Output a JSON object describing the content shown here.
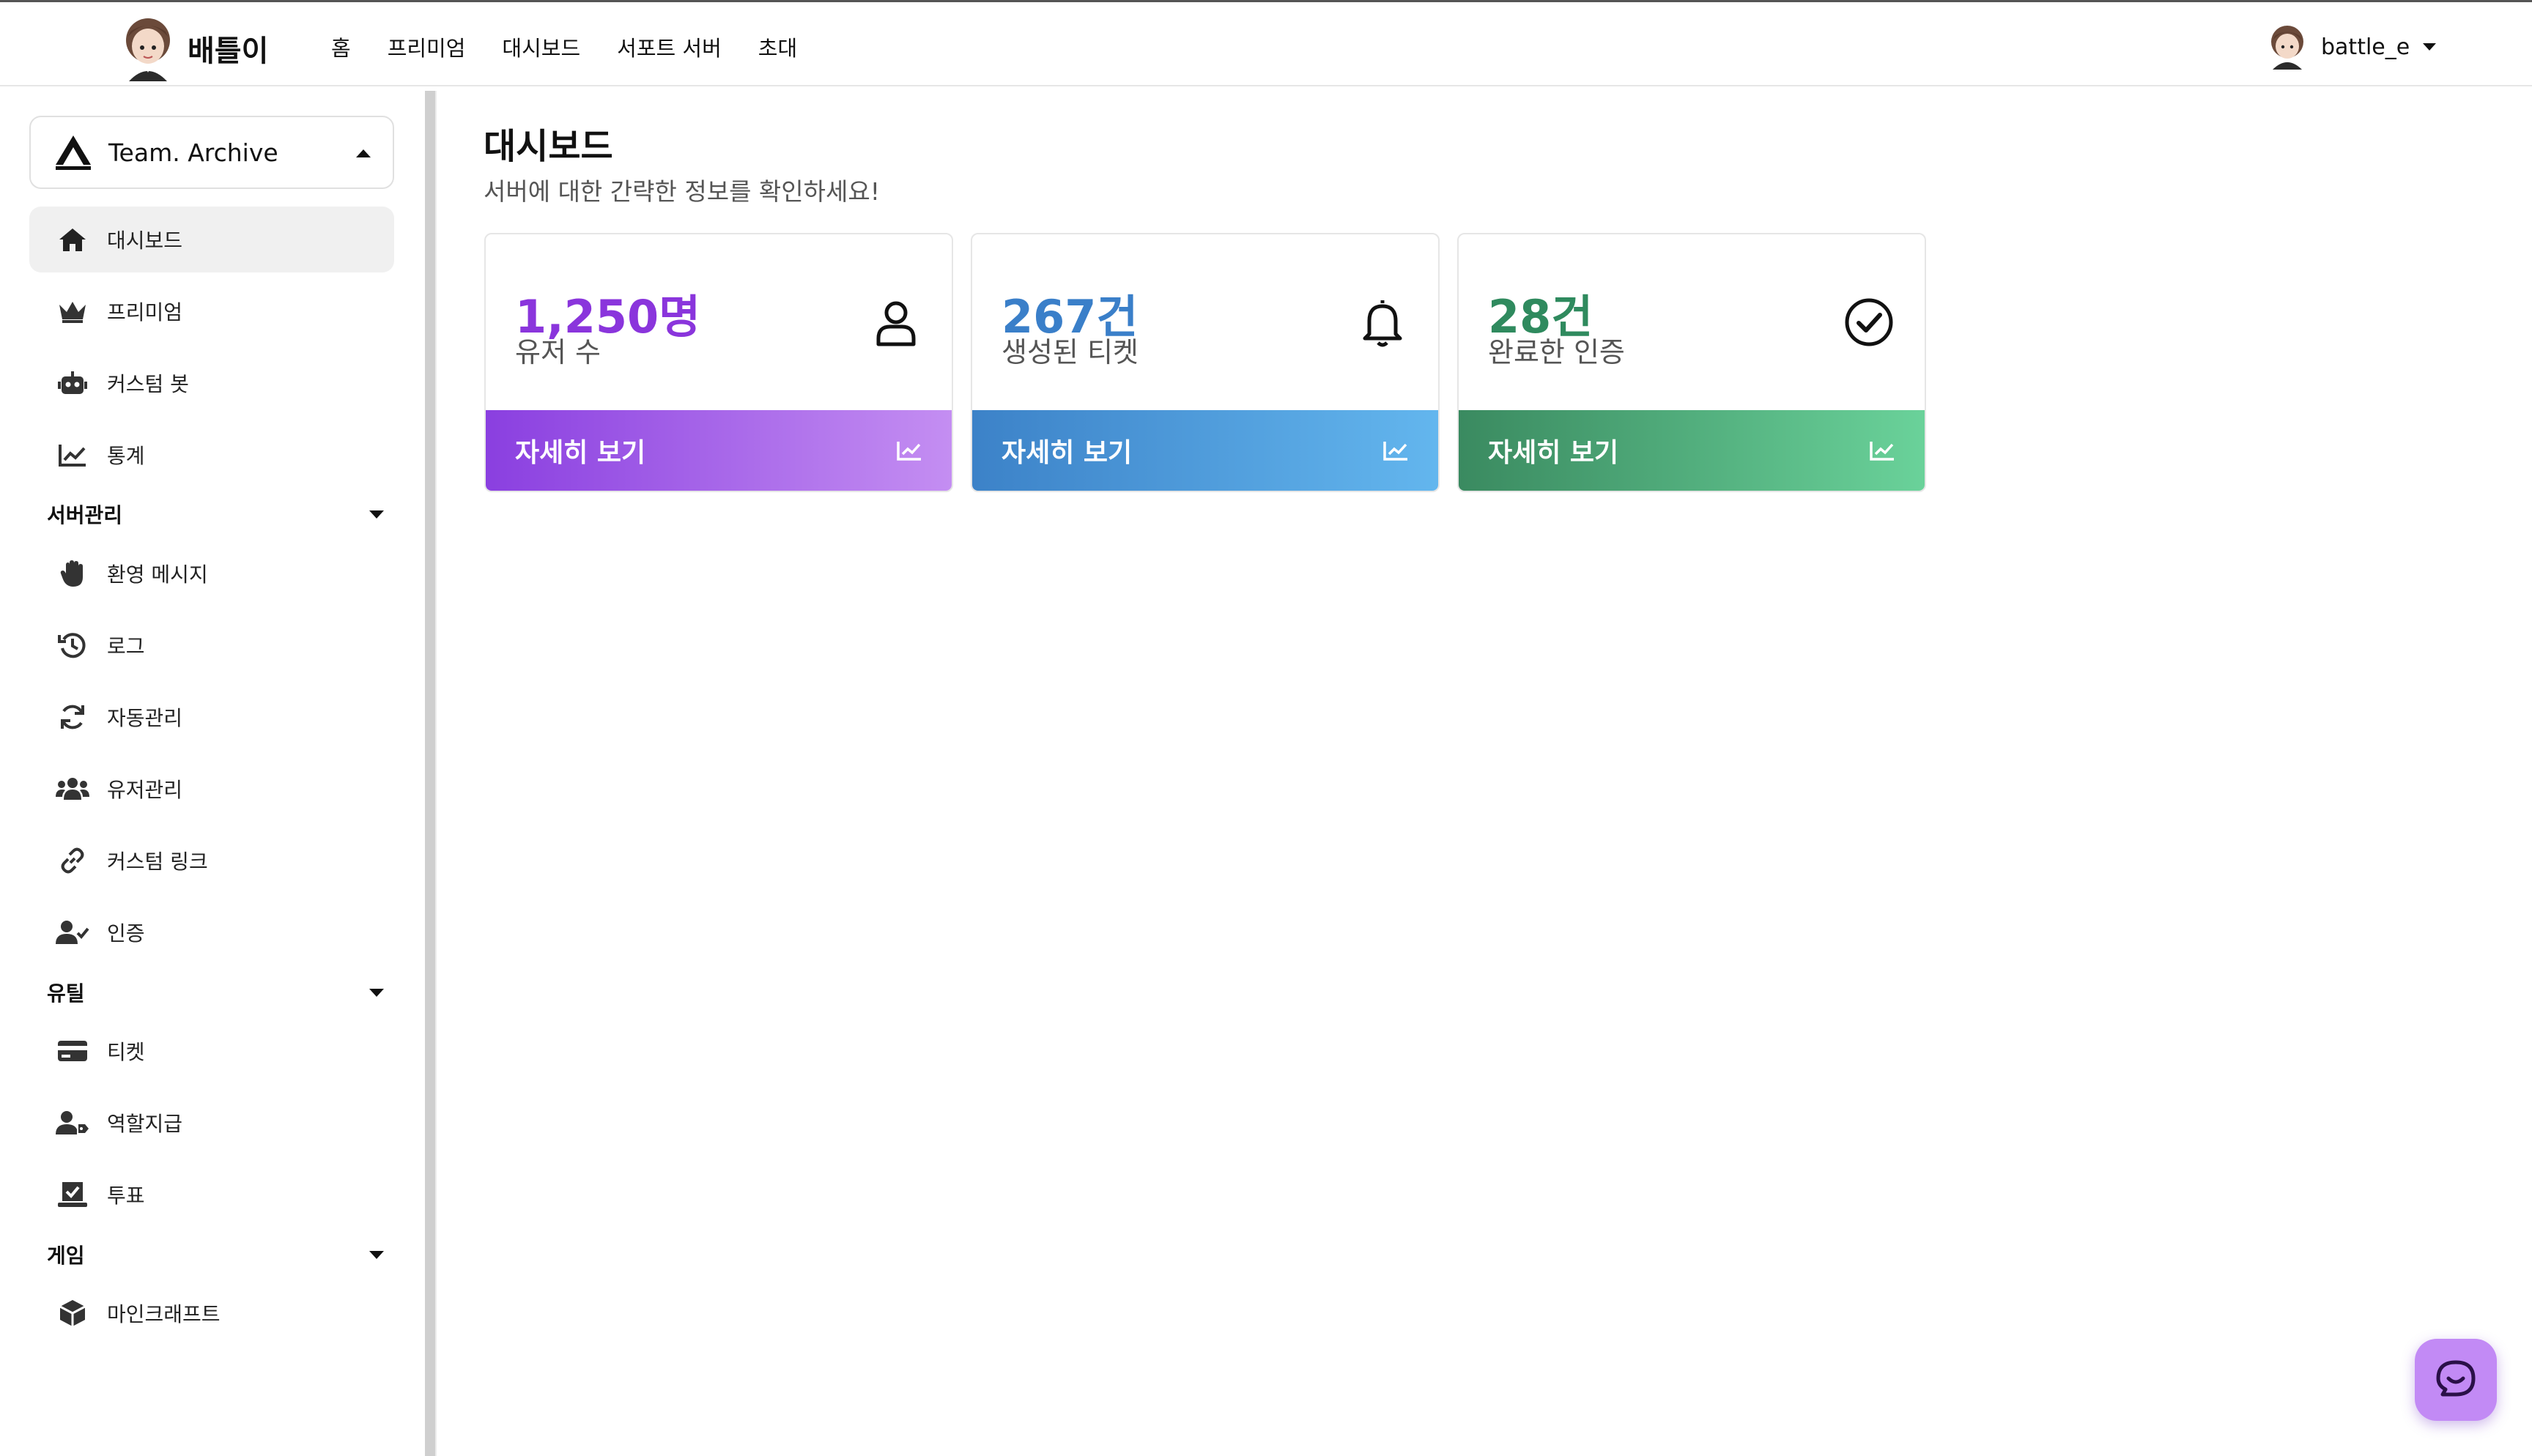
{
  "brand": {
    "name": "배틀이"
  },
  "nav": {
    "items": [
      "홈",
      "프리미엄",
      "대시보드",
      "서포트 서버",
      "초대"
    ]
  },
  "user": {
    "name": "battle_e"
  },
  "team": {
    "name": "Team. Archive"
  },
  "sidebar": {
    "top_items": [
      {
        "label": "대시보드",
        "icon": "home-icon",
        "active": true
      },
      {
        "label": "프리미엄",
        "icon": "crown-icon"
      },
      {
        "label": "커스텀 봇",
        "icon": "robot-icon"
      },
      {
        "label": "통계",
        "icon": "chart-line-icon"
      }
    ],
    "sections": [
      {
        "label": "서버관리",
        "items": [
          {
            "label": "환영 메시지",
            "icon": "hand-icon"
          },
          {
            "label": "로그",
            "icon": "history-icon"
          },
          {
            "label": "자동관리",
            "icon": "sync-icon"
          },
          {
            "label": "유저관리",
            "icon": "users-icon"
          },
          {
            "label": "커스텀 링크",
            "icon": "link-icon"
          },
          {
            "label": "인증",
            "icon": "user-check-icon"
          }
        ]
      },
      {
        "label": "유틸",
        "items": [
          {
            "label": "티켓",
            "icon": "card-icon"
          },
          {
            "label": "역할지급",
            "icon": "user-tag-icon"
          },
          {
            "label": "투표",
            "icon": "vote-icon"
          }
        ]
      },
      {
        "label": "게임",
        "items": [
          {
            "label": "마인크래프트",
            "icon": "cube-icon"
          }
        ]
      }
    ]
  },
  "main": {
    "title": "대시보드",
    "subtitle": "서버에 대한 간략한 정보를 확인하세요!",
    "cards": [
      {
        "value": "1,250명",
        "label": "유저 수",
        "button": "자세히 보기",
        "icon": "user-icon",
        "color": "#8a35dc",
        "gradient": [
          "#8a3fe0",
          "#c48ef2"
        ]
      },
      {
        "value": "267건",
        "label": "생성된 티켓",
        "button": "자세히 보기",
        "icon": "bell-icon",
        "color": "#3a7fc9",
        "gradient": [
          "#3c82c8",
          "#63b6ee"
        ]
      },
      {
        "value": "28건",
        "label": "완료한 인증",
        "button": "자세히 보기",
        "icon": "check-circle-icon",
        "color": "#2f8a5e",
        "gradient": [
          "#3a8a60",
          "#6ad29a"
        ]
      }
    ]
  },
  "chat": {
    "icon": "chat-icon"
  }
}
